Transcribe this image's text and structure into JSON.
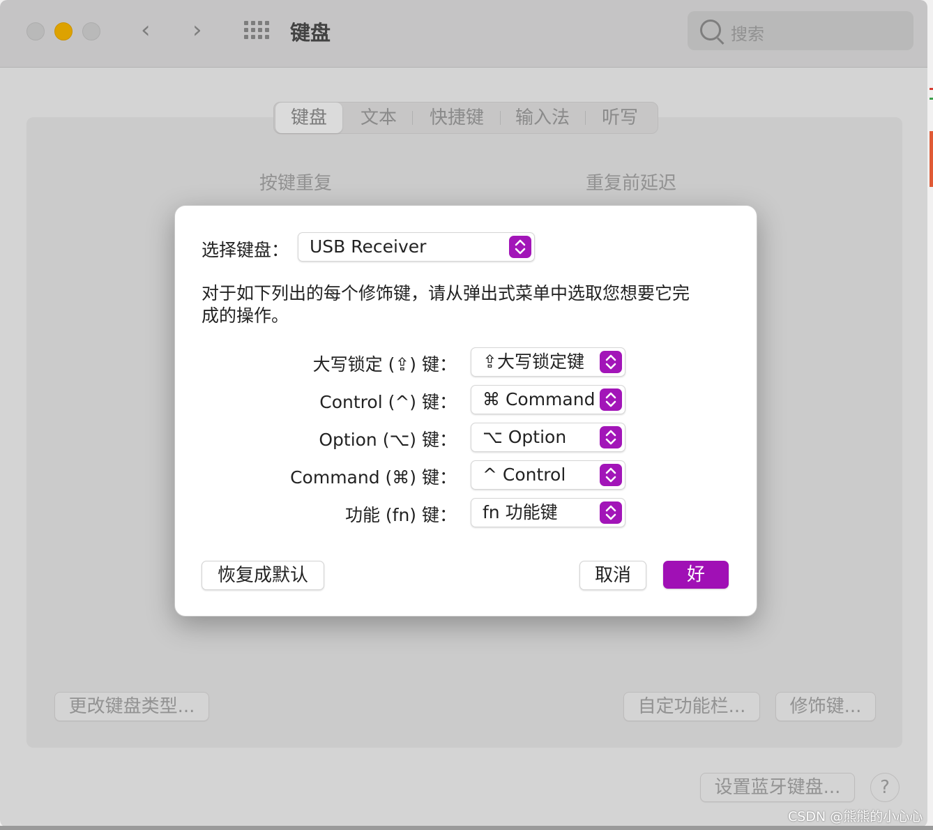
{
  "window": {
    "title": "键盘",
    "search_placeholder": "搜索",
    "tabs": [
      "键盘",
      "文本",
      "快捷键",
      "输入法",
      "听写"
    ],
    "selected_tab": "键盘",
    "labels": {
      "key_repeat": "按键重复",
      "delay_until_repeat": "重复前延迟"
    },
    "buttons": {
      "change_keyboard_type": "更改键盘类型...",
      "customize_touch_bar": "自定功能栏...",
      "modifier_keys": "修饰键...",
      "setup_bluetooth_keyboard": "设置蓝牙键盘...",
      "help": "?"
    }
  },
  "dialog": {
    "select_keyboard_label": "选择键盘：",
    "selected_keyboard": "USB Receiver",
    "instructions_line1": "对于如下列出的每个修饰键，请从弹出式菜单中选取您想要它完",
    "instructions_line2": "成的操作。",
    "rows": [
      {
        "label": "大写锁定 (⇪) 键：",
        "value": "⇪大写锁定键"
      },
      {
        "label": "Control (^) 键：",
        "value": "⌘ Command"
      },
      {
        "label": "Option (⌥) 键：",
        "value": "⌥ Option"
      },
      {
        "label": "Command (⌘) 键：",
        "value": "^ Control"
      },
      {
        "label": "功能 (fn) 键：",
        "value": "fn 功能键"
      }
    ],
    "buttons": {
      "restore_defaults": "恢复成默认",
      "cancel": "取消",
      "ok": "好"
    }
  },
  "watermark": "CSDN @熊熊的小心心",
  "colors": {
    "accent": "#a010b5",
    "minimize": "#f7b500"
  }
}
